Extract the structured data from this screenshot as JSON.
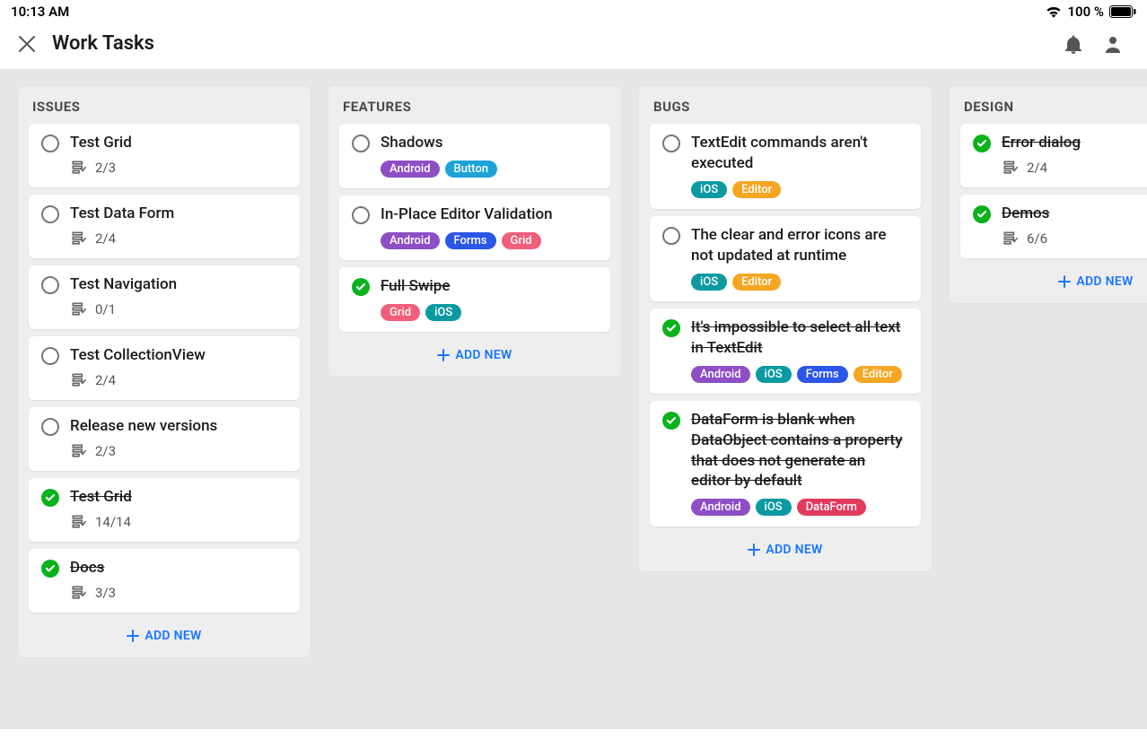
{
  "status_bar": {
    "time": "10:13 AM",
    "battery": "100 %"
  },
  "header": {
    "title": "Work Tasks"
  },
  "tag_colors": {
    "Android": "#8e4ec6",
    "Button": "#1da2d8",
    "Forms": "#2a57e8",
    "Grid": "#f05e7b",
    "iOS": "#0b9aa2",
    "Editor": "#f5a623",
    "DataForm": "#e03a5f"
  },
  "add_new_label": "ADD NEW",
  "columns": [
    {
      "title": "ISSUES",
      "cards": [
        {
          "title": "Test Grid",
          "done": false,
          "sub": "2/3",
          "tags": []
        },
        {
          "title": "Test Data Form",
          "done": false,
          "sub": "2/4",
          "tags": []
        },
        {
          "title": "Test Navigation",
          "done": false,
          "sub": "0/1",
          "tags": []
        },
        {
          "title": "Test CollectionView",
          "done": false,
          "sub": "2/4",
          "tags": []
        },
        {
          "title": "Release new versions",
          "done": false,
          "sub": "2/3",
          "tags": []
        },
        {
          "title": "Test Grid",
          "done": true,
          "sub": "14/14",
          "tags": []
        },
        {
          "title": "Docs",
          "done": true,
          "sub": "3/3",
          "tags": []
        }
      ]
    },
    {
      "title": "FEATURES",
      "cards": [
        {
          "title": "Shadows",
          "done": false,
          "sub": "",
          "tags": [
            "Android",
            "Button"
          ]
        },
        {
          "title": "In-Place Editor Validation",
          "done": false,
          "sub": "",
          "tags": [
            "Android",
            "Forms",
            "Grid"
          ]
        },
        {
          "title": "Full Swipe",
          "done": true,
          "sub": "",
          "tags": [
            "Grid",
            "iOS"
          ]
        }
      ]
    },
    {
      "title": "BUGS",
      "cards": [
        {
          "title": "TextEdit commands aren't executed",
          "done": false,
          "sub": "",
          "tags": [
            "iOS",
            "Editor"
          ]
        },
        {
          "title": "The clear and error icons are not updated at runtime",
          "done": false,
          "sub": "",
          "tags": [
            "iOS",
            "Editor"
          ]
        },
        {
          "title": "It's impossible to select all text in TextEdit",
          "done": true,
          "sub": "",
          "tags": [
            "Android",
            "iOS",
            "Forms",
            "Editor"
          ]
        },
        {
          "title": "DataForm is blank when DataObject contains a property that does not generate an editor by default",
          "done": true,
          "sub": "",
          "tags": [
            "Android",
            "iOS",
            "DataForm"
          ]
        }
      ]
    },
    {
      "title": "DESIGN",
      "cards": [
        {
          "title": "Error dialog",
          "done": true,
          "sub": "2/4",
          "tags": []
        },
        {
          "title": "Demos",
          "done": true,
          "sub": "6/6",
          "tags": []
        }
      ]
    }
  ]
}
